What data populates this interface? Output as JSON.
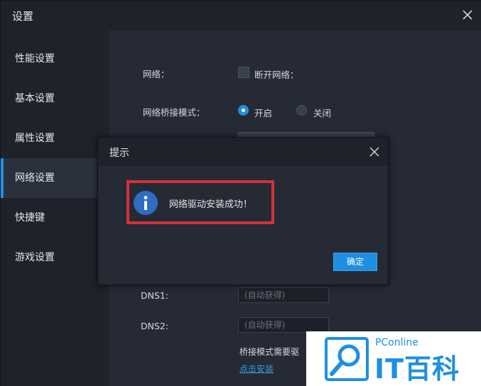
{
  "window": {
    "title": "设置"
  },
  "sidebar": {
    "items": [
      {
        "label": "性能设置"
      },
      {
        "label": "基本设置"
      },
      {
        "label": "属性设置"
      },
      {
        "label": "网络设置",
        "active": true
      },
      {
        "label": "快捷键"
      },
      {
        "label": "游戏设置"
      }
    ]
  },
  "network": {
    "network_label": "网络：",
    "disconnect_label": "断开网络：",
    "disconnect_checked": false,
    "bridge_mode_label": "网络桥接模式：",
    "bridge_on_label": "开启",
    "bridge_off_label": "关闭",
    "bridge_mode_selected": "开启",
    "dns1_label": "DNS1:",
    "dns1_placeholder": "(自动获得)",
    "dns2_label": "DNS2:",
    "dns2_placeholder": "(自动获得)",
    "bridge_note": "桥接模式需要驱",
    "install_link": "点击安装"
  },
  "dialog": {
    "title": "提示",
    "message": "网络驱动安装成功！",
    "ok_label": "确定"
  },
  "watermark": {
    "site": "PConline",
    "brand": "IT百科"
  },
  "colors": {
    "accent": "#1e8fe1",
    "highlight_border": "#d6303a",
    "background": "#262a35",
    "sidebar": "#1f222a"
  },
  "icons": [
    "close-icon",
    "info-icon",
    "checkbox",
    "radio"
  ]
}
